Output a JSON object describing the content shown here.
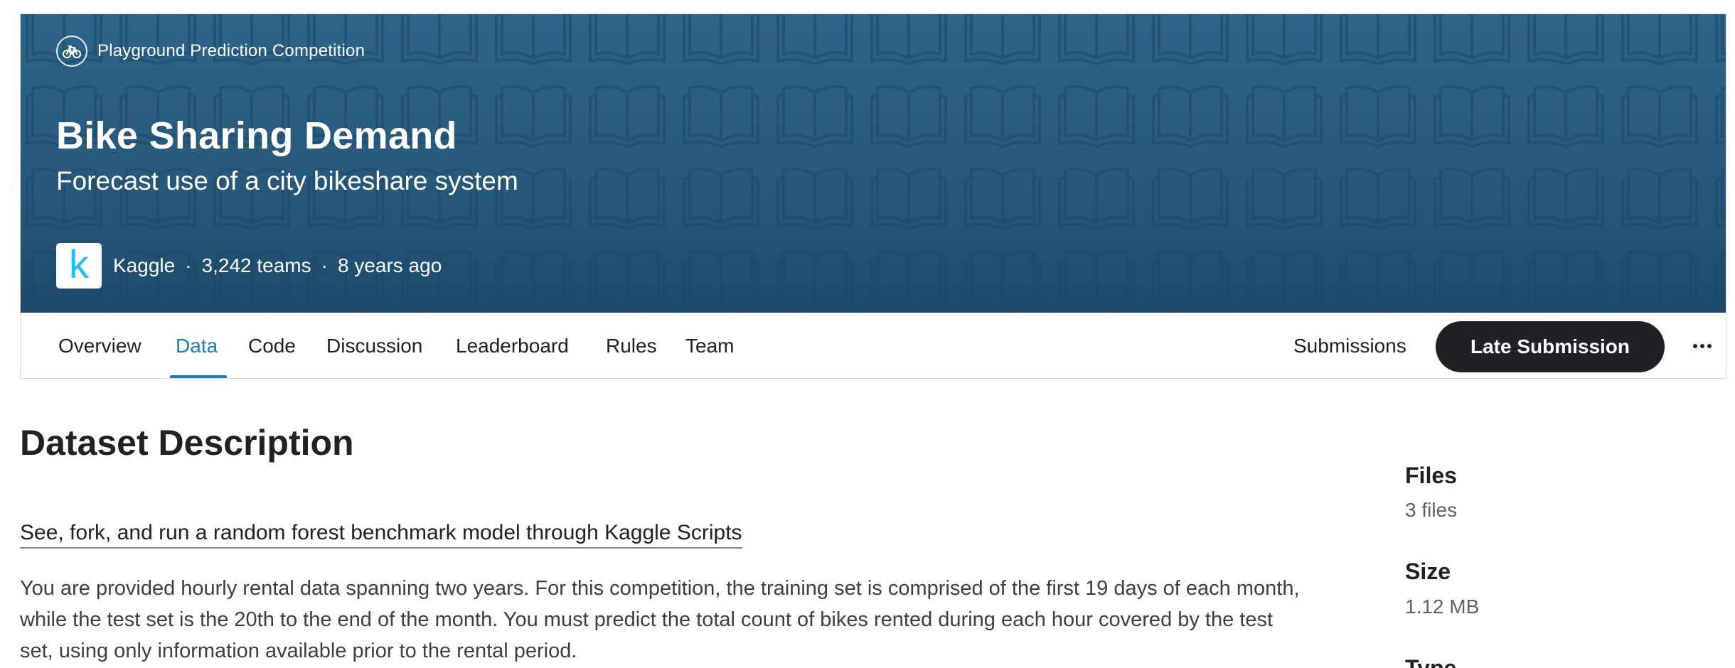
{
  "competition": {
    "type_label": "Playground Prediction Competition",
    "type_icon": "bicycle-icon",
    "title": "Bike Sharing Demand",
    "subtitle": "Forecast use of a city bikeshare system",
    "host": "Kaggle",
    "host_logo_letter": "k",
    "teams": "3,242 teams",
    "age": "8 years ago",
    "separator": "·"
  },
  "tabs": [
    {
      "label": "Overview",
      "active": false
    },
    {
      "label": "Data",
      "active": true
    },
    {
      "label": "Code",
      "active": false
    },
    {
      "label": "Discussion",
      "active": false
    },
    {
      "label": "Leaderboard",
      "active": false
    },
    {
      "label": "Rules",
      "active": false
    },
    {
      "label": "Team",
      "active": false
    }
  ],
  "actions": {
    "submissions_label": "Submissions",
    "late_submission_label": "Late Submission",
    "more_icon": "more-horizontal-icon"
  },
  "dataset": {
    "heading": "Dataset Description",
    "benchmark_link": "See, fork, and run a random forest benchmark model through Kaggle Scripts",
    "description_lines": [
      "You are provided hourly rental data spanning two years. For this competition, the training set is comprised of the first 19 days of each month,",
      "while the test set is the 20th to the end of the month. You must predict the total count of bikes rented during each hour covered by the test",
      "set, using only information available prior to the rental period."
    ]
  },
  "sidebar": {
    "files_label": "Files",
    "files_value": "3 files",
    "size_label": "Size",
    "size_value": "1.12 MB",
    "type_label": "Type"
  },
  "colors": {
    "banner": "#27597c",
    "accent": "#1f7cb5",
    "button": "#202124",
    "kaggle_blue": "#20beff"
  }
}
